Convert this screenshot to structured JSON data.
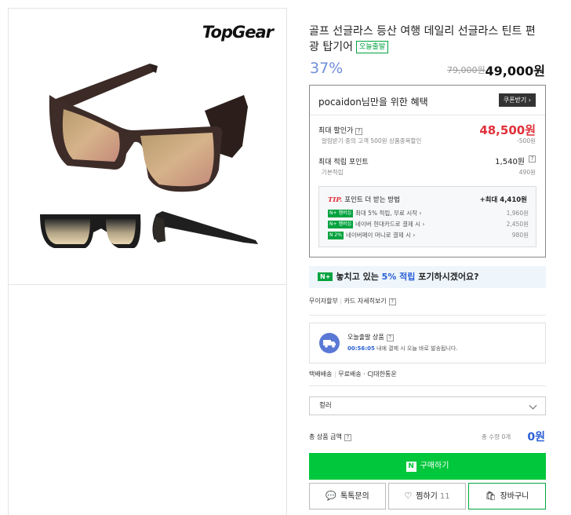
{
  "product": {
    "brand_logo": "TopGear",
    "title": "골프 선글라스 등산 여행 데일리 선글라스 틴트 편광 탑기어",
    "today_badge": "오늘출발",
    "discount": "37%",
    "original_price": "79,000원",
    "sale_price": "49,000원"
  },
  "benefits": {
    "heading": "pocaidon님만을 위한 혜택",
    "coupon_button": "쿠폰받기",
    "max_discount_label": "최대 할인가",
    "max_discount_value": "48,500원",
    "max_discount_sub": "알림받기 중의 고객 500원 상품중복할인",
    "max_discount_subval": "-500원",
    "max_points_label": "최대 적립 포인트",
    "max_points_value": "1,540원",
    "base_points_label": "기본적립",
    "base_points_value": "490원",
    "tip": {
      "word": "TIP.",
      "heading": "포인트 더 받는 방법",
      "max": "+최대 4,410원",
      "lines": [
        {
          "tag": "멤버십",
          "text": "최대 5% 적립, 무료 시작",
          "value": "1,960원"
        },
        {
          "tag": "멤버십",
          "text": "네이버 현대카드로 결제 시",
          "value": "2,450원"
        },
        {
          "tag": "2%",
          "text": "네이버페이 머니로 결제 시",
          "value": "980원"
        }
      ]
    }
  },
  "promo": {
    "n_label": "N+",
    "prefix": "놓치고 있는 ",
    "accent": "5% 적립",
    "suffix": " 포기하시겠어요?"
  },
  "links": {
    "installment": "무이자할부",
    "card_details": "카드 자세히보기"
  },
  "shipping": {
    "title": "오늘출발 상품",
    "time": "00:56:05",
    "message": " 내에 결제 시 오늘 바로 발송됩니다."
  },
  "delivery": {
    "method": "택배배송",
    "fee": "무료배송",
    "carrier": "CJ대한통운"
  },
  "option_select": {
    "placeholder": "컬러"
  },
  "total": {
    "label": "총 상품 금액",
    "qty": "총 수량 0개",
    "amount": "0원"
  },
  "actions": {
    "buy": "구매하기",
    "talk": "톡톡문의",
    "wish": "찜하기",
    "wish_count": "11",
    "cart": "장바구니"
  },
  "colors": {
    "green": "#00c73c",
    "red": "#e0303a",
    "blue": "#2a5fd6"
  }
}
